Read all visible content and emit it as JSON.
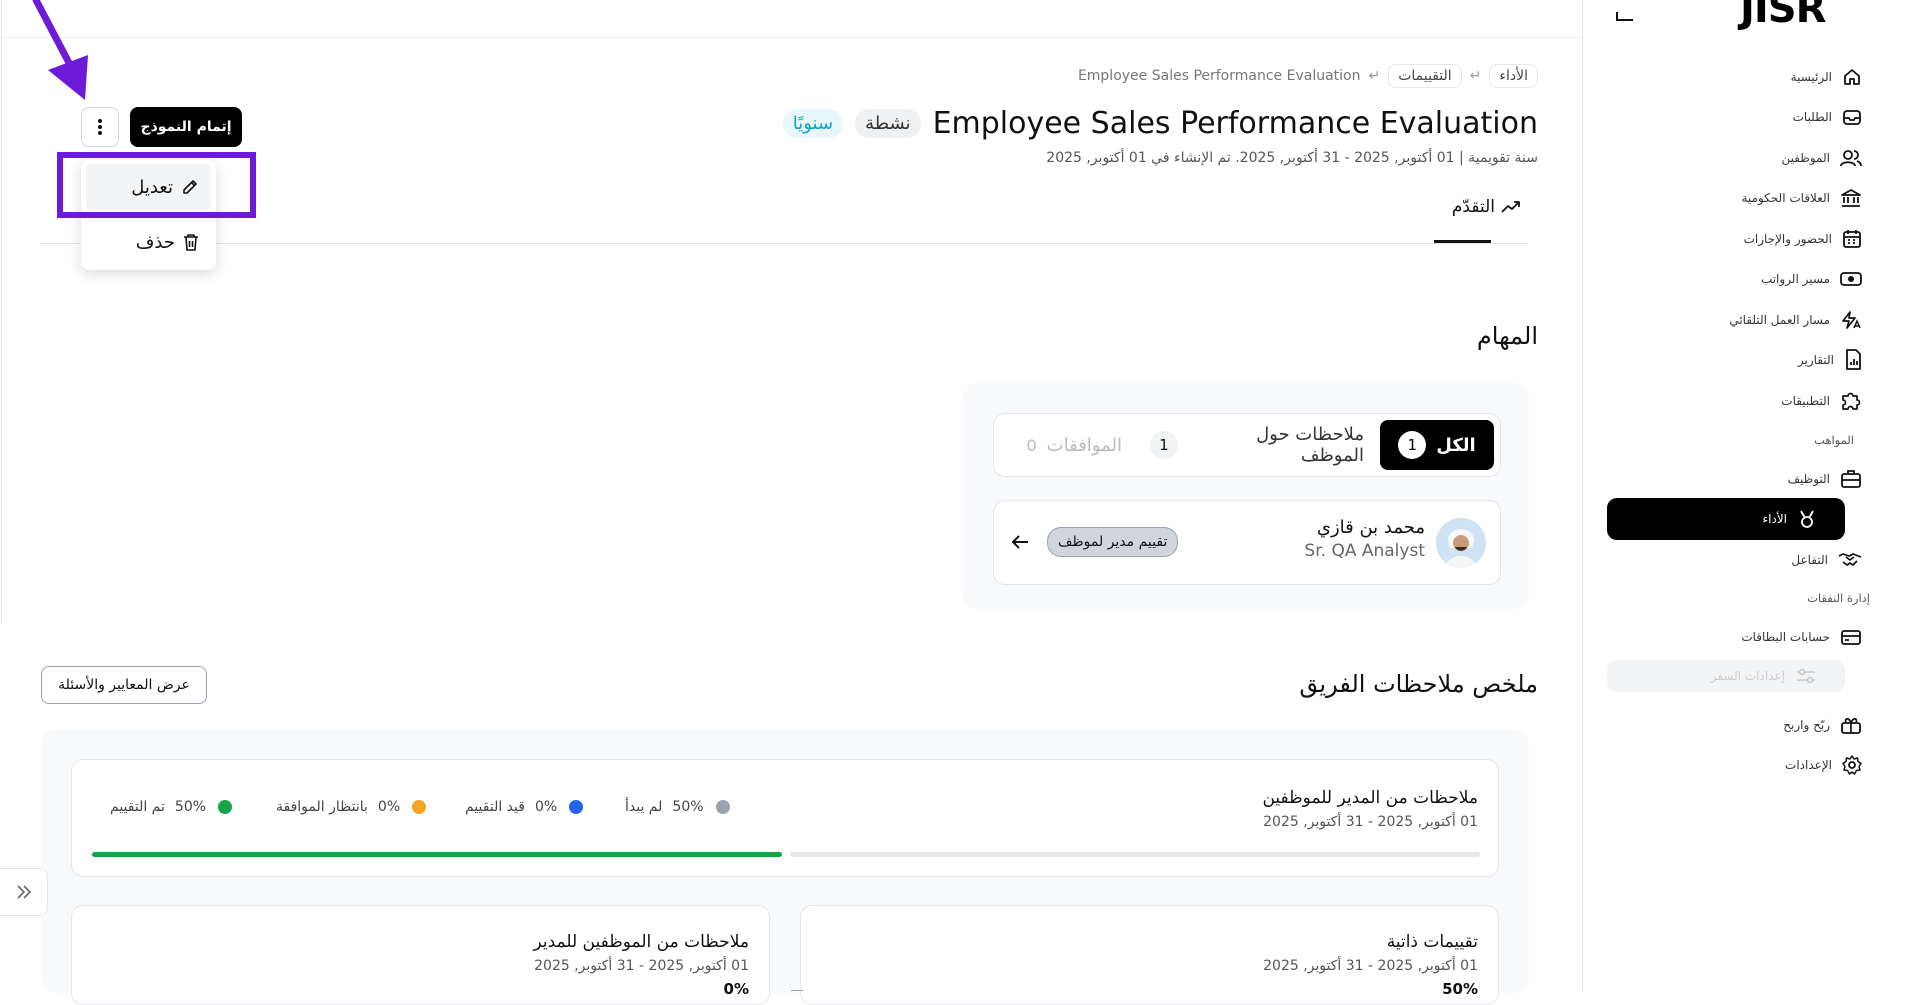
{
  "sidebar": {
    "brand": "JISR",
    "items": [
      {
        "label": "الرئيسية",
        "icon": "home-icon"
      },
      {
        "label": "الطلبات",
        "icon": "inbox-icon"
      },
      {
        "label": "الموظفين",
        "icon": "users-icon"
      },
      {
        "label": "العلاقات الحكومية",
        "icon": "bank-icon"
      },
      {
        "label": "الحضور والإجازات",
        "icon": "calendar-icon"
      },
      {
        "label": "مسير الرواتب",
        "icon": "money-icon"
      },
      {
        "label": "مسار العمل التلقائي",
        "icon": "automation-icon"
      },
      {
        "label": "التقارير",
        "icon": "report-icon"
      },
      {
        "label": "التطبيقات",
        "icon": "puzzle-icon"
      }
    ],
    "section_talent": "المواهب",
    "talent_items": [
      {
        "label": "التوظيف",
        "icon": "briefcase-icon"
      },
      {
        "label": "الأداء",
        "icon": "medal-icon"
      },
      {
        "label": "التفاعل",
        "icon": "handshake-icon"
      }
    ],
    "section_expenses": "إدارة النفقات",
    "expense_items": [
      {
        "label": "حسابات البطاقات",
        "icon": "card-icon"
      },
      {
        "label": "إعدادات السفر",
        "icon": "travel-settings-icon"
      }
    ],
    "bottom_items": [
      {
        "label": "ربّح واربح",
        "icon": "gift-icon"
      },
      {
        "label": "الإعدادات",
        "icon": "gear-icon"
      }
    ]
  },
  "breadcrumb": {
    "items": [
      "الأداء",
      "التقييمات",
      "Employee Sales Performance Evaluation"
    ]
  },
  "header": {
    "title": "Employee Sales Performance Evaluation",
    "status_badge": "نشطة",
    "frequency_badge": "سنويًا",
    "subtitle": "سنة تقويمية | 01 أكتوبر, 2025 - 31 أكتوبر, 2025. تم الإنشاء في 01 أكتوبر, 2025",
    "complete_button": "إتمام النموذج"
  },
  "menu": {
    "edit": "تعديل",
    "delete": "حذف"
  },
  "tabs": {
    "progress": "التقدّم"
  },
  "tasks": {
    "heading": "المهام",
    "filter_all": "الكل",
    "filter_all_count": "1",
    "filter_feedback": "ملاحظات حول الموظف",
    "filter_feedback_count": "1",
    "filter_approvals": "الموافقات",
    "filter_approvals_count": "0",
    "employee_name": "محمد بن قازي",
    "employee_role": "Sr. QA Analyst",
    "review_tag": "تقييم مدير لموظف"
  },
  "summary": {
    "heading": "ملخص ملاحظات الفريق",
    "criteria_button": "عرض المعايير والأسئلة",
    "manager_card": {
      "title": "ملاحظات من المدير للموظفين",
      "dates": "01 أكتوبر, 2025 - 31 أكتوبر, 2025",
      "progress": 0.5,
      "legend": [
        {
          "label": "لم يبدأ",
          "value": "50%",
          "color": "#9ca3af"
        },
        {
          "label": "قيد التقييم",
          "value": "0%",
          "color": "#2563eb"
        },
        {
          "label": "بانتظار الموافقة",
          "value": "0%",
          "color": "#f5a623"
        },
        {
          "label": "تم التقييم",
          "value": "50%",
          "color": "#16a34a"
        }
      ]
    },
    "self_card": {
      "title": "تقييمات ذاتية",
      "dates": "01 أكتوبر, 2025 - 31 أكتوبر, 2025",
      "percent": "50%"
    },
    "peer_card": {
      "title": "ملاحظات من الموظفين للمدير",
      "dates": "01 أكتوبر, 2025 - 31 أكتوبر, 2025",
      "percent": "0%"
    }
  },
  "colors": {
    "annotation": "#6d1bd9",
    "accent_black": "#000000",
    "green": "#16a34a"
  }
}
